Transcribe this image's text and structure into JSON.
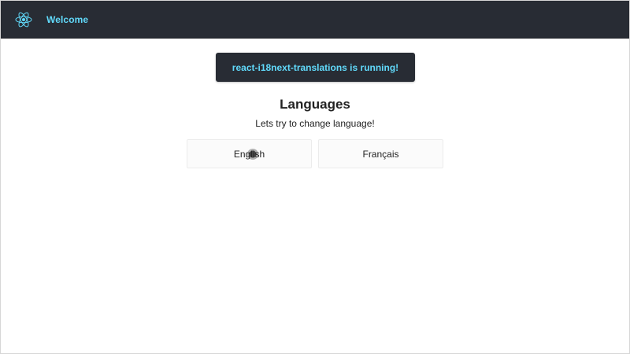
{
  "header": {
    "logo_icon": "react-logo-icon",
    "nav_link": "Welcome",
    "accent_color": "#61dafb",
    "background_color": "#282c34"
  },
  "banner": {
    "text": "react-i18next-translations is running!"
  },
  "languages": {
    "title": "Languages",
    "subtitle": "Lets try to change language!",
    "options": [
      "English",
      "Français"
    ]
  }
}
